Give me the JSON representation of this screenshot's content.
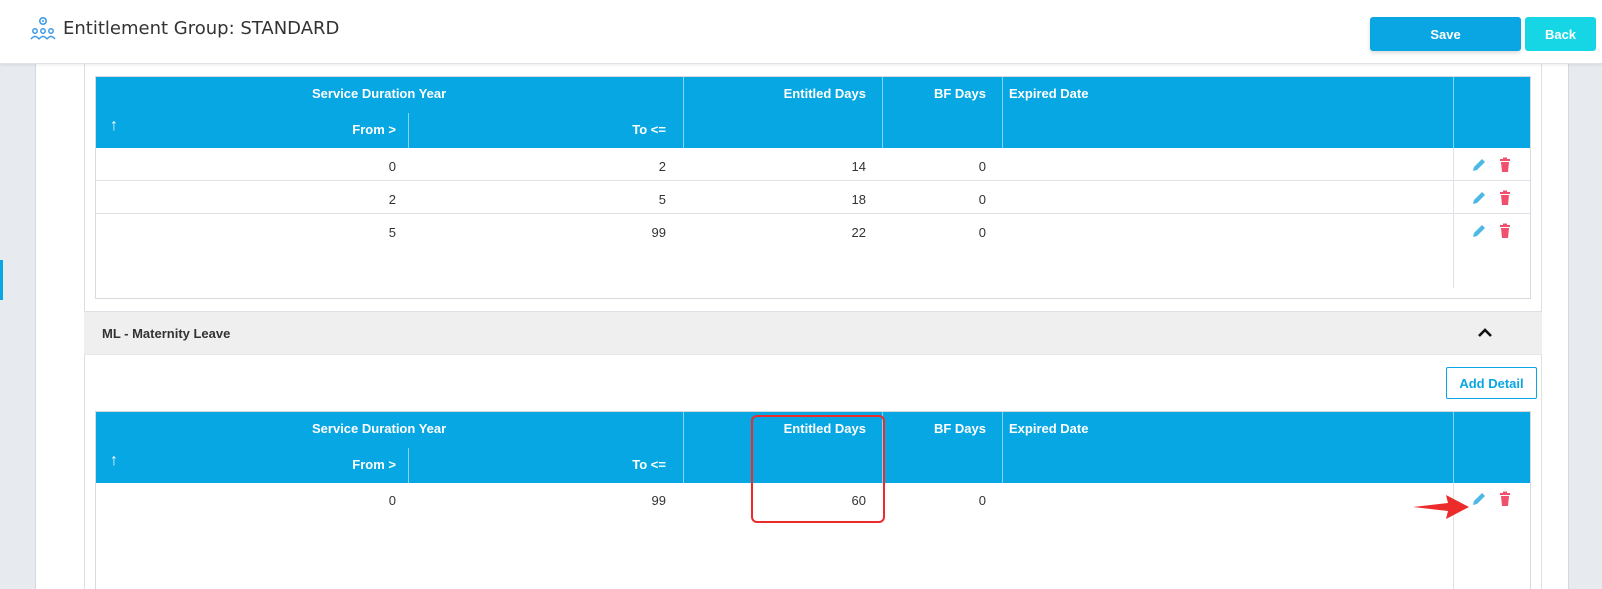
{
  "header": {
    "title": "Entitlement Group: STANDARD",
    "save_label": "Save",
    "back_label": "Back"
  },
  "columns": {
    "group": "Service Duration Year",
    "from": "From >",
    "to": "To <=",
    "entitled": "Entitled Days",
    "bf": "BF Days",
    "expired": "Expired Date",
    "sort_glyph": "↑"
  },
  "grid_top": {
    "rows": [
      {
        "from": "0",
        "to": "2",
        "entitled": "14",
        "bf": "0",
        "expired": ""
      },
      {
        "from": "2",
        "to": "5",
        "entitled": "18",
        "bf": "0",
        "expired": ""
      },
      {
        "from": "5",
        "to": "99",
        "entitled": "22",
        "bf": "0",
        "expired": ""
      }
    ]
  },
  "section_ml": {
    "title": "ML - Maternity Leave",
    "add_label": "Add Detail",
    "rows": [
      {
        "from": "0",
        "to": "99",
        "entitled": "60",
        "bf": "0",
        "expired": ""
      }
    ]
  },
  "icons": {
    "title": "people-group-icon",
    "edit": "pencil-icon",
    "delete": "trash-icon",
    "collapse": "chevron-up-icon",
    "annotation": "red-arrow"
  },
  "colors": {
    "accent": "#07a7e4",
    "back": "#16d6e6",
    "delete": "#f0506e",
    "edit": "#4bb8e6",
    "annotation": "#ec2b2b"
  }
}
